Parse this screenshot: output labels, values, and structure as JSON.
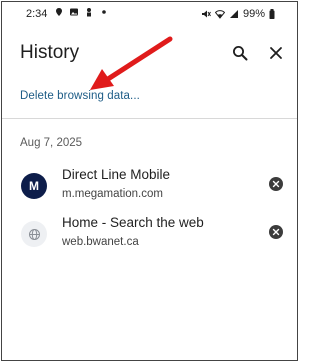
{
  "status_bar": {
    "time": "2:34",
    "left_icons": [
      "location-pin-icon",
      "image-icon",
      "person-icon",
      "dot-icon"
    ],
    "battery": "99%",
    "right_icons": [
      "mute-icon",
      "wifi-icon",
      "signal-icon",
      "battery-icon"
    ]
  },
  "header": {
    "title": "History",
    "search_icon": "search-icon",
    "close_icon": "close-icon"
  },
  "delete_link": "Delete browsing data...",
  "sections": [
    {
      "date": "Aug 7, 2025",
      "items": [
        {
          "title": "Direct Line Mobile",
          "url": "m.megamation.com",
          "favicon": "M",
          "favicon_color": "#0d1d4a"
        },
        {
          "title": "Home - Search the web",
          "url": "web.bwanet.ca",
          "favicon": "globe-icon",
          "favicon_color": "#eef0f3"
        }
      ]
    }
  ],
  "annotation": {
    "arrow_color": "#e01b1b"
  },
  "colors": {
    "link": "#1d5c86",
    "text": "#1f1f1f",
    "secondary": "#444444"
  }
}
